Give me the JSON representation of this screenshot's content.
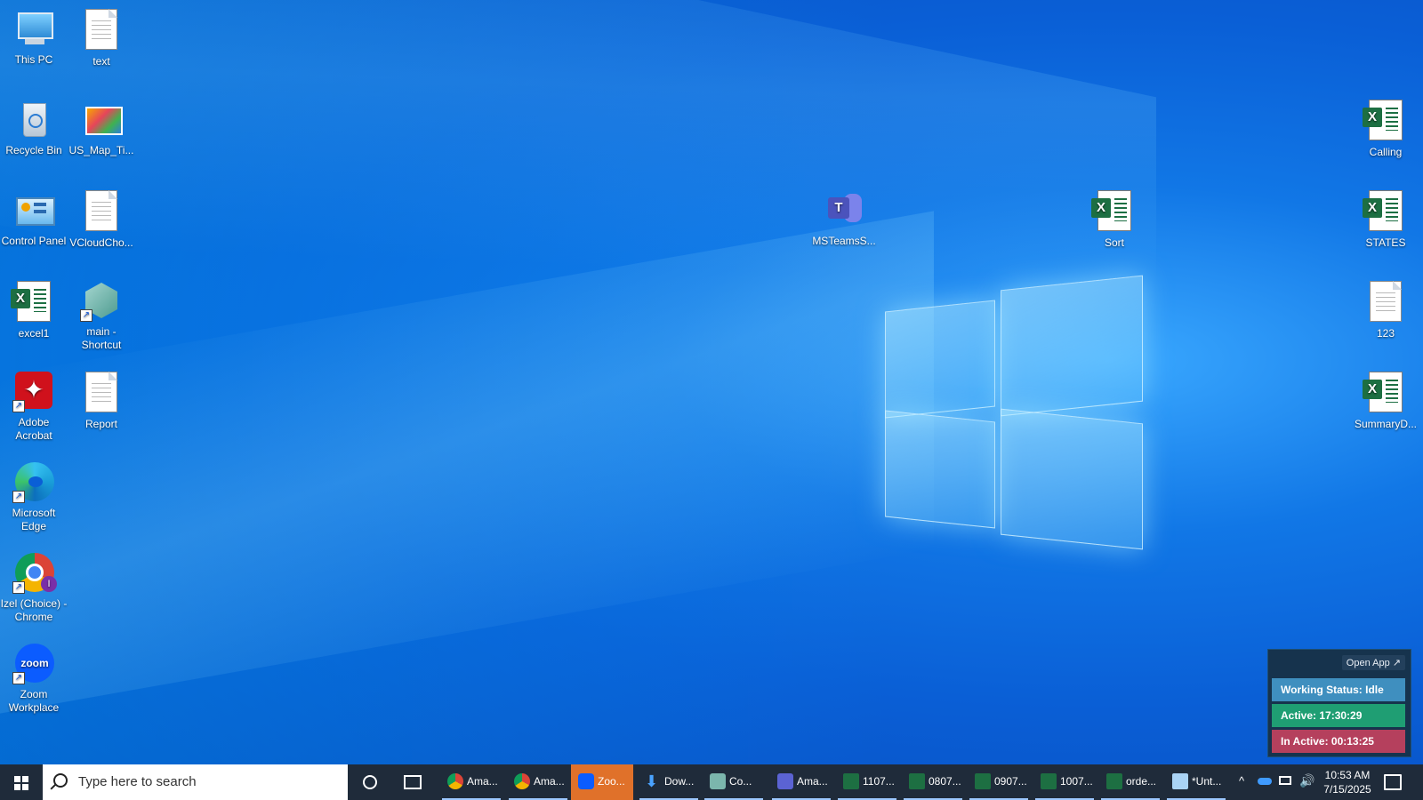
{
  "desktop": {
    "icons": [
      {
        "label": "This PC"
      },
      {
        "label": "text"
      },
      {
        "label": "Recycle Bin"
      },
      {
        "label": "US_Map_Ti..."
      },
      {
        "label": "Control Panel"
      },
      {
        "label": "VCloudCho..."
      },
      {
        "label": "excel1"
      },
      {
        "label": "main - Shortcut"
      },
      {
        "label": "Adobe Acrobat"
      },
      {
        "label": "Report"
      },
      {
        "label": "Microsoft Edge"
      },
      {
        "label": "Izel (Choice) - Chrome"
      },
      {
        "label": "Zoom Workplace"
      },
      {
        "label": "MSTeamsS..."
      },
      {
        "label": "Sort"
      },
      {
        "label": "Calling"
      },
      {
        "label": "STATES"
      },
      {
        "label": "123"
      },
      {
        "label": "SummaryD..."
      }
    ]
  },
  "widget": {
    "open_app": "Open App ↗",
    "working_status": "Working Status: Idle",
    "active": "Active: 17:30:29",
    "inactive": "In Active: 00:13:25"
  },
  "taskbar": {
    "search_placeholder": "Type here to search",
    "tasks": [
      {
        "label": "Ama..."
      },
      {
        "label": "Ama..."
      },
      {
        "label": "Zoo..."
      },
      {
        "label": "Dow..."
      },
      {
        "label": "Co..."
      },
      {
        "label": "Ama..."
      },
      {
        "label": "1107..."
      },
      {
        "label": "0807..."
      },
      {
        "label": "0907..."
      },
      {
        "label": "1007..."
      },
      {
        "label": "orde..."
      },
      {
        "label": "*Unt..."
      }
    ],
    "time": "10:53 AM",
    "date": "7/15/2025"
  },
  "colors": {
    "working_status": "#3f8fbf",
    "active": "#1f9e73",
    "inactive": "#b5405d",
    "active_task": "#e0712a"
  }
}
